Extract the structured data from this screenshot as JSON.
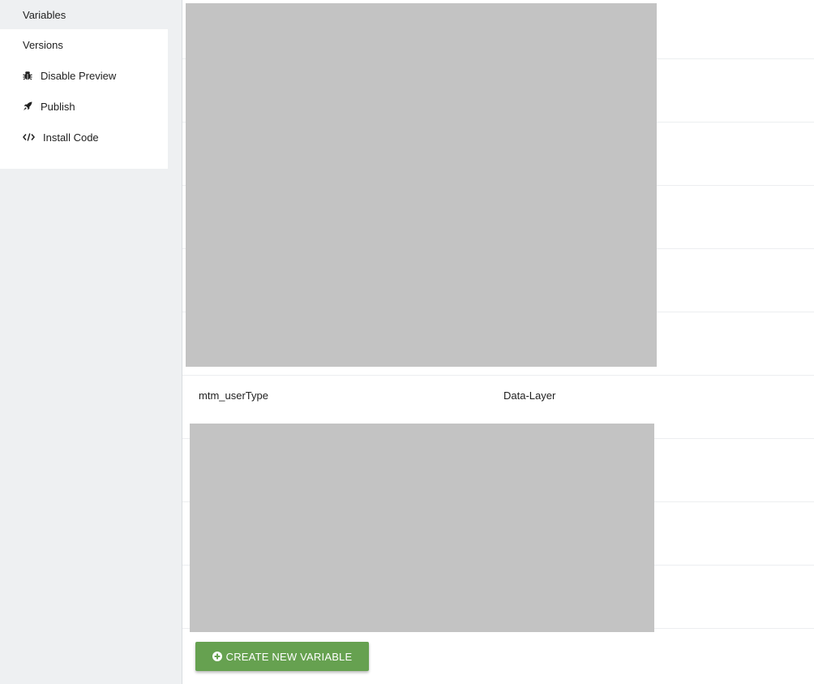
{
  "sidebar": {
    "items": [
      {
        "label": "Variables",
        "icon": null
      },
      {
        "label": "Versions",
        "icon": null
      },
      {
        "label": "Disable Preview",
        "icon": "bug-icon"
      },
      {
        "label": "Publish",
        "icon": "rocket-icon"
      },
      {
        "label": "Install Code",
        "icon": "code-icon"
      }
    ]
  },
  "table": {
    "visible_row": {
      "name": "mtm_userType",
      "type": "Data-Layer"
    }
  },
  "actions": {
    "create_label": "CREATE NEW VARIABLE"
  },
  "colors": {
    "sidebar_bg": "#eef0f2",
    "button_green": "#66a150",
    "redacted_gray": "#c3c3c3"
  }
}
